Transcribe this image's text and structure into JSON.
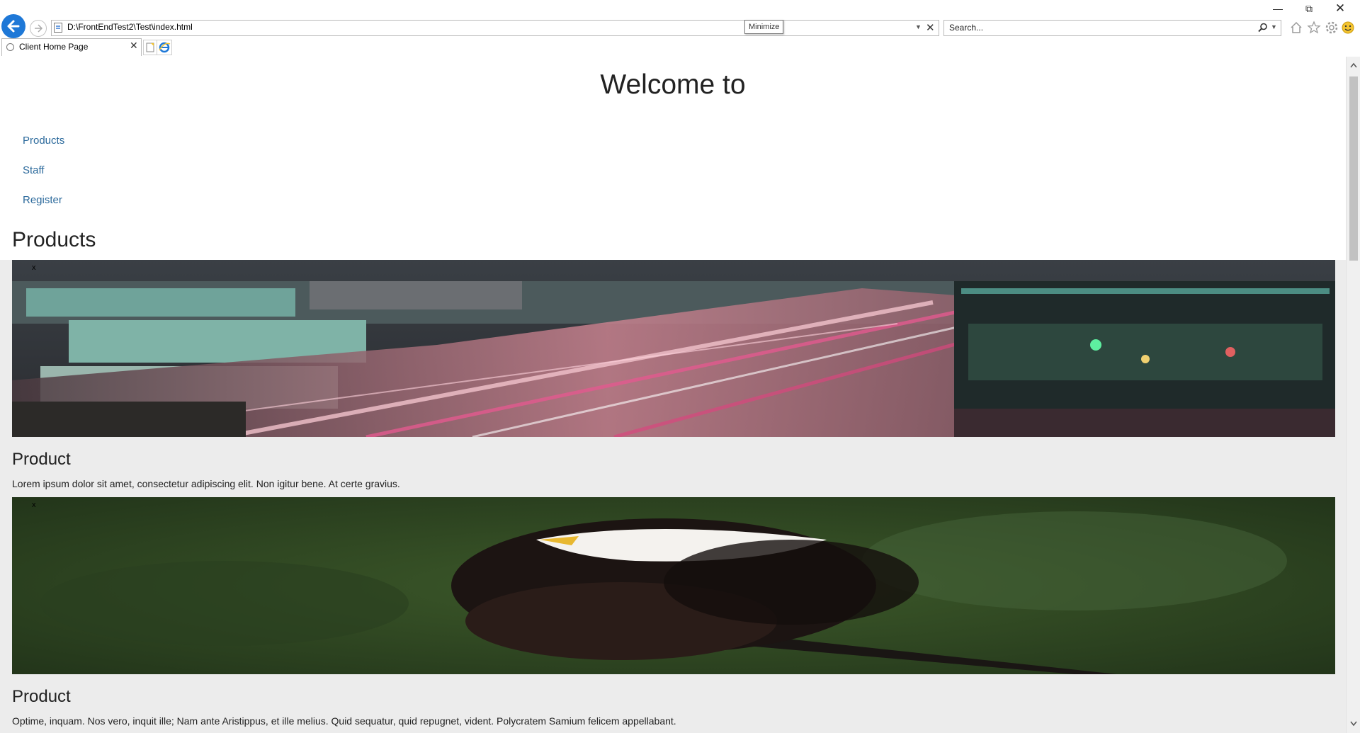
{
  "browser": {
    "address": "D:\\FrontEndTest2\\Test\\index.html",
    "tooltip": "Minimize",
    "search_placeholder": "Search...",
    "tab_title": "Client Home Page"
  },
  "page": {
    "welcome": "Welcome to",
    "nav": [
      "Products",
      "Staff",
      "Register"
    ],
    "section_title": "Products",
    "products": [
      {
        "title": "Product",
        "description": "Lorem ipsum dolor sit amet, consectetur adipiscing elit. Non igitur bene. At certe gravius.",
        "image": "city-night-traffic-image",
        "broken_marker": "x"
      },
      {
        "title": "Product",
        "description": "Optime, inquam. Nos vero, inquit ille; Nam ante Aristippus, et ille melius. Quid sequatur, quid repugnet, vident. Polycratem Samium felicem appellabant.",
        "image": "bald-eagle-image",
        "broken_marker": "x"
      }
    ]
  },
  "colors": {
    "accent": "#1e78d7",
    "link": "#2c6a9c",
    "page_bg": "#ececec"
  }
}
